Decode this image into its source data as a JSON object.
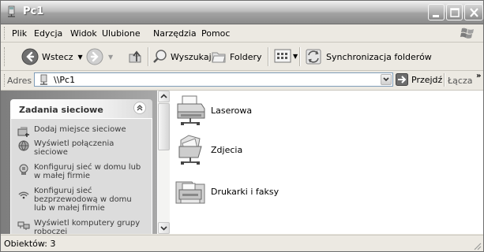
{
  "window": {
    "title": "Pc1"
  },
  "menu": {
    "items": [
      "Plik",
      "Edycja",
      "Widok",
      "Ulubione",
      "Narzędzia",
      "Pomoc"
    ]
  },
  "toolbar": {
    "back_label": "Wstecz",
    "search_label": "Wyszukaj",
    "folders_label": "Foldery",
    "sync_label": "Synchronizacja folderów"
  },
  "address": {
    "label": "Adres",
    "value": "\\\\Pc1",
    "go_label": "Przejdź",
    "links_label": "Łącza"
  },
  "tasks": {
    "title": "Zadania sieciowe",
    "items": [
      {
        "label": "Dodaj miejsce sieciowe",
        "icon": "add-network-place-icon"
      },
      {
        "label": "Wyświetl połączenia sieciowe",
        "icon": "network-connections-icon"
      },
      {
        "label": "Konfiguruj sieć w domu lub w małej firmie",
        "icon": "home-network-setup-icon"
      },
      {
        "label": "Konfiguruj sieć bezprzewodową w domu lub w małej firmie",
        "icon": "wireless-setup-icon"
      },
      {
        "label": "Wyświetl komputery grupy roboczej",
        "icon": "workgroup-computers-icon"
      }
    ]
  },
  "files": [
    {
      "label": "Laserowa",
      "icon": "shared-printer-icon"
    },
    {
      "label": "Zdjecia",
      "icon": "shared-folder-icon"
    },
    {
      "label": "Drukarki i faksy",
      "icon": "printers-faxes-icon"
    }
  ],
  "status": {
    "text": "Obiektów: 3"
  }
}
